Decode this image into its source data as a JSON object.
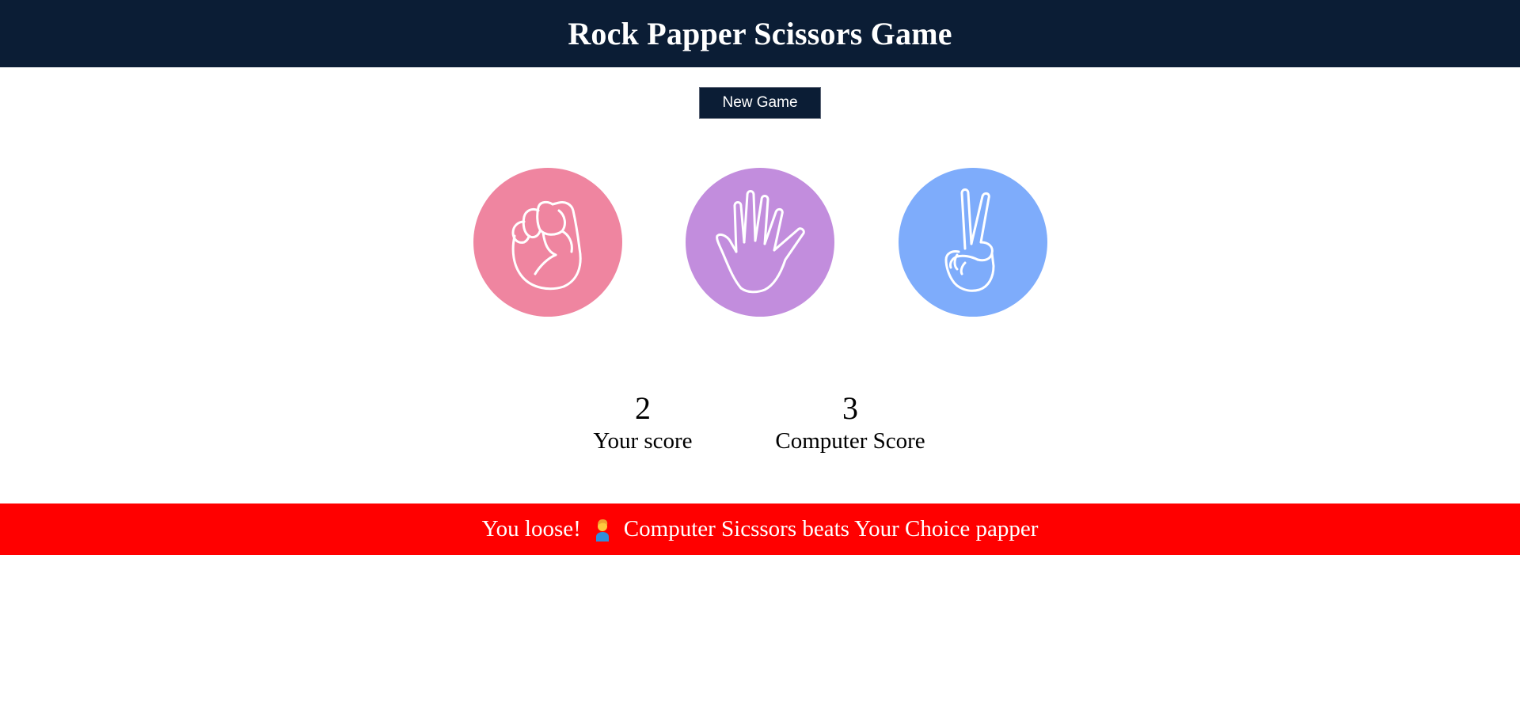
{
  "header": {
    "title": "Rock Papper Scissors Game",
    "background": "#0b1d35"
  },
  "controls": {
    "new_game_label": "New Game"
  },
  "choices": [
    {
      "id": "rock",
      "icon": "fist-icon",
      "color": "#ef85a0"
    },
    {
      "id": "paper",
      "icon": "open-hand-icon",
      "color": "#c28ddd"
    },
    {
      "id": "scissors",
      "icon": "peace-sign-icon",
      "color": "#7eacfb"
    }
  ],
  "scores": {
    "user_value": "2",
    "user_label": "Your score",
    "computer_value": "3",
    "computer_label": "Computer Score"
  },
  "result": {
    "prefix": "You loose!",
    "emoji": "person-emoji",
    "text": "Computer Sicssors beats Your Choice papper",
    "background": "#ff0000"
  }
}
